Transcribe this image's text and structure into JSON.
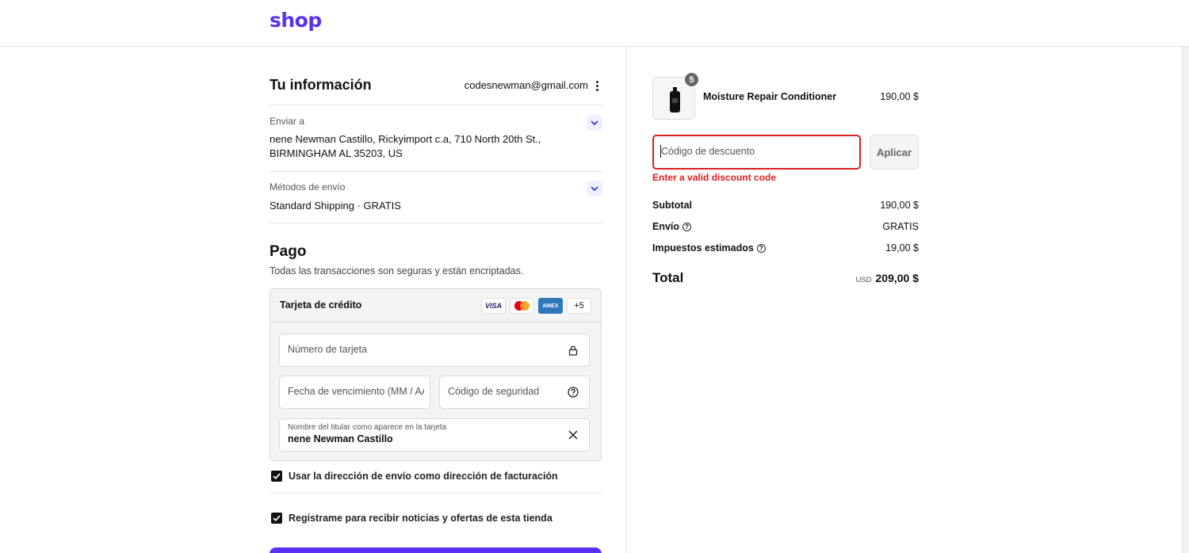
{
  "header": {
    "logo": "shop"
  },
  "info": {
    "title": "Tu información",
    "email": "codesnewman@gmail.com",
    "ship_to_label": "Enviar a",
    "ship_to_value": "nene Newman Castillo, Rickyimport c.a, 710 North 20th St., BIRMINGHAM AL 35203, US",
    "shipping_methods_label": "Métodos de envío",
    "shipping_method_value": "Standard Shipping · GRATIS"
  },
  "payment": {
    "title": "Pago",
    "subtitle": "Todas las transacciones son seguras y están encriptadas.",
    "method_label": "Tarjeta de crédito",
    "brands": {
      "visa": "VISA",
      "amex": "AMEX",
      "more": "+5"
    },
    "card_number_placeholder": "Número de tarjeta",
    "expiry_placeholder": "Fecha de vencimiento (MM / AA)",
    "security_code_placeholder": "Código de seguridad",
    "cardholder_label": "Nombre del titular como aparece en la tarjeta",
    "cardholder_value": "nene Newman Castillo",
    "billing_same_label": "Usar la dirección de envío como dirección de facturación",
    "newsletter_label": "Regístrame para recibir noticias y ofertas de esta tienda",
    "billing_same_checked": true,
    "newsletter_checked": true
  },
  "cart": {
    "product_name": "Moisture Repair Conditioner",
    "product_price": "190,00 $",
    "quantity": "5",
    "discount_placeholder": "Código de descuento",
    "apply_label": "Aplicar",
    "error": "Enter a valid discount code",
    "subtotal_label": "Subtotal",
    "subtotal_value": "190,00 $",
    "shipping_label": "Envío",
    "shipping_value": "GRATIS",
    "taxes_label": "Impuestos estimados",
    "taxes_value": "19,00 $",
    "total_label": "Total",
    "currency": "USD",
    "total_value": "209,00 $"
  },
  "colors": {
    "brand": "#5a31f4",
    "error": "#dd1d1d",
    "amex": "#2e77bb"
  }
}
